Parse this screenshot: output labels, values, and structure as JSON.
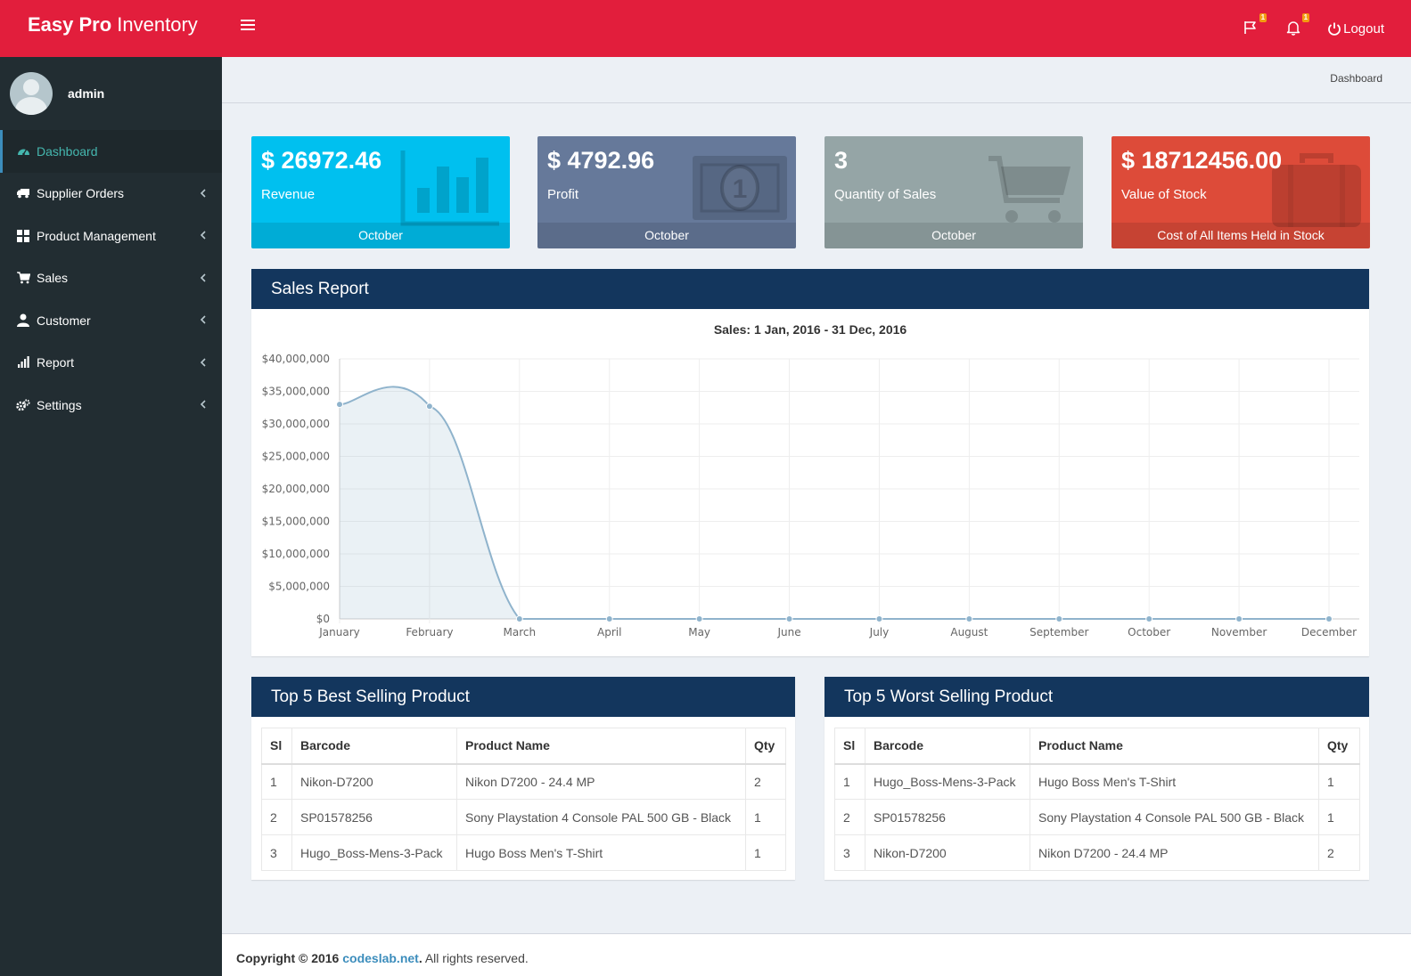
{
  "brand": {
    "bold": "Easy Pro",
    "rest": " Inventory"
  },
  "header": {
    "flag_badge": "1",
    "bell_badge": "1",
    "logout": "Logout",
    "colors": {
      "topbar": "#e21e3c",
      "badge": "#f39c12"
    }
  },
  "user": {
    "name": "admin"
  },
  "sidebar": {
    "items": [
      {
        "label": "Dashboard",
        "icon": "dashboard-icon"
      },
      {
        "label": "Supplier Orders",
        "icon": "truck-icon"
      },
      {
        "label": "Product Management",
        "icon": "th-large-icon"
      },
      {
        "label": "Sales",
        "icon": "cart-icon"
      },
      {
        "label": "Customer",
        "icon": "user-icon"
      },
      {
        "label": "Report",
        "icon": "bar-chart-icon"
      },
      {
        "label": "Settings",
        "icon": "gears-icon"
      }
    ]
  },
  "breadcrumb": "Dashboard",
  "tiles": [
    {
      "value": "$ 26972.46",
      "label": "Revenue",
      "footer": "October",
      "color": "#00c0ef",
      "icon": "bar-chart-icon"
    },
    {
      "value": "$ 4792.96",
      "label": "Profit",
      "footer": "October",
      "color": "#66799a",
      "icon": "money-icon"
    },
    {
      "value": "3",
      "label": "Quantity of Sales",
      "footer": "October",
      "color": "#95a5a6",
      "icon": "cart-icon"
    },
    {
      "value": "$ 18712456.00",
      "label": "Value of Stock",
      "footer": "Cost of All Items Held in Stock",
      "color": "#dd4b39",
      "icon": "briefcase-icon"
    }
  ],
  "sales_report": {
    "title": "Sales Report"
  },
  "chart_data": {
    "type": "area",
    "title": "Sales: 1 Jan, 2016 - 31 Dec, 2016",
    "x": [
      "January",
      "February",
      "March",
      "April",
      "May",
      "June",
      "July",
      "August",
      "September",
      "October",
      "November",
      "December"
    ],
    "series": [
      {
        "values": [
          33000000,
          32700000,
          0,
          0,
          0,
          0,
          0,
          0,
          0,
          0,
          0,
          0
        ]
      }
    ],
    "ylim": [
      0,
      40000000
    ],
    "yticks": [
      "$0",
      "$5,000,000",
      "$10,000,000",
      "$15,000,000",
      "$20,000,000",
      "$25,000,000",
      "$30,000,000",
      "$35,000,000",
      "$40,000,000"
    ],
    "grid": true,
    "color": "#8fb3cc"
  },
  "best": {
    "title": "Top 5 Best Selling Product",
    "headers": [
      "Sl",
      "Barcode",
      "Product Name",
      "Qty"
    ],
    "rows": [
      [
        "1",
        "Nikon-D7200",
        "Nikon D7200 - 24.4 MP",
        "2"
      ],
      [
        "2",
        "SP01578256",
        "Sony Playstation 4 Console PAL 500 GB - Black",
        "1"
      ],
      [
        "3",
        "Hugo_Boss-Mens-3-Pack",
        "Hugo Boss Men's T-Shirt",
        "1"
      ]
    ]
  },
  "worst": {
    "title": "Top 5 Worst Selling Product",
    "headers": [
      "Sl",
      "Barcode",
      "Product Name",
      "Qty"
    ],
    "rows": [
      [
        "1",
        "Hugo_Boss-Mens-3-Pack",
        "Hugo Boss Men's T-Shirt",
        "1"
      ],
      [
        "2",
        "SP01578256",
        "Sony Playstation 4 Console PAL 500 GB - Black",
        "1"
      ],
      [
        "3",
        "Nikon-D7200",
        "Nikon D7200 - 24.4 MP",
        "2"
      ]
    ]
  },
  "footer": {
    "prefix": "Copyright © 2016 ",
    "link": "codeslab.net",
    "suffix": ". All rights reserved."
  }
}
